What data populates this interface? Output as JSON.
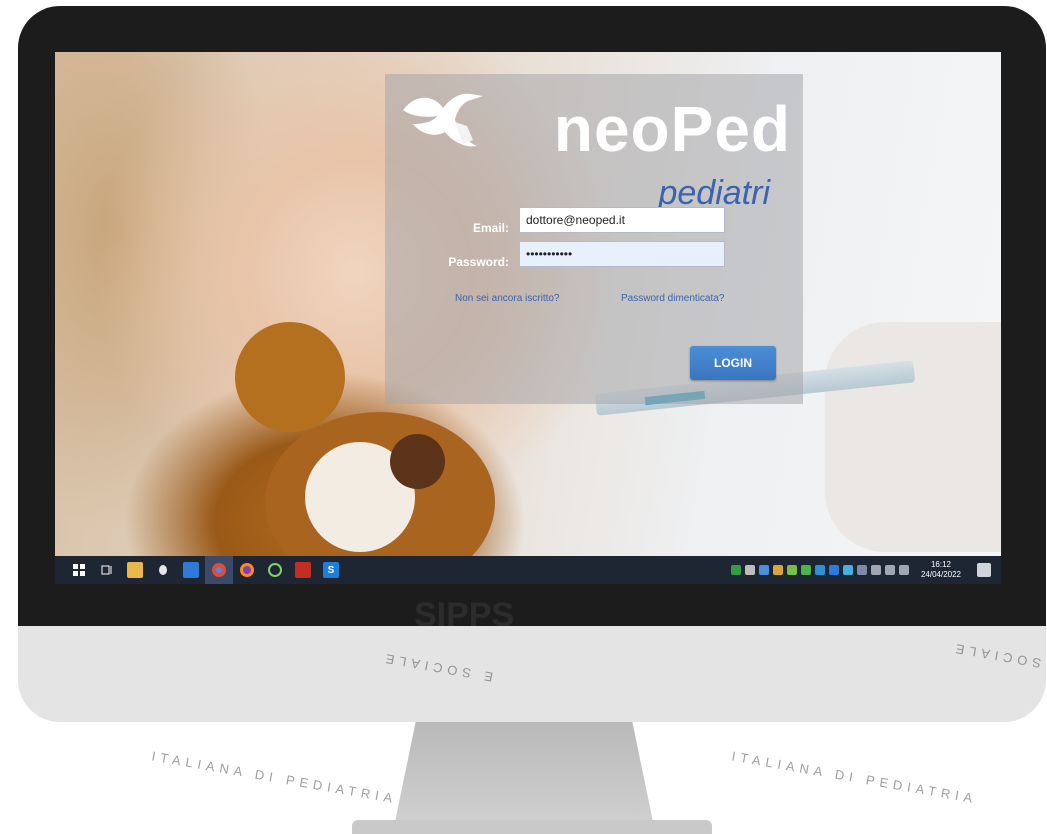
{
  "app": {
    "title": "neoPed",
    "subtitle": "pediatri"
  },
  "login": {
    "email_label": "Email:",
    "email_value": "dottore@neoped.it",
    "password_label": "Password:",
    "password_value": "•••••••••••",
    "not_registered_link": "Non sei ancora iscritto?",
    "forgot_password_link": "Password dimenticata?",
    "login_button": "LOGIN"
  },
  "taskbar": {
    "apps": [
      "start-icon",
      "task-view-icon",
      "file-explorer-icon",
      "alien-icon",
      "outlook-icon",
      "chrome-icon",
      "firefox-icon",
      "recycle-icon",
      "acrobat-icon",
      "skype-icon"
    ],
    "time": "16:12",
    "date": "24/04/2022"
  },
  "watermark": {
    "top_arc": "ITALIANA DI PEDIATRIA",
    "bottom_arc": "E SOCIALE",
    "brand": "SIPPS"
  },
  "colors": {
    "accent": "#3c63ad",
    "login_button": "#4b8fd6",
    "taskbar": "#1f2633"
  }
}
